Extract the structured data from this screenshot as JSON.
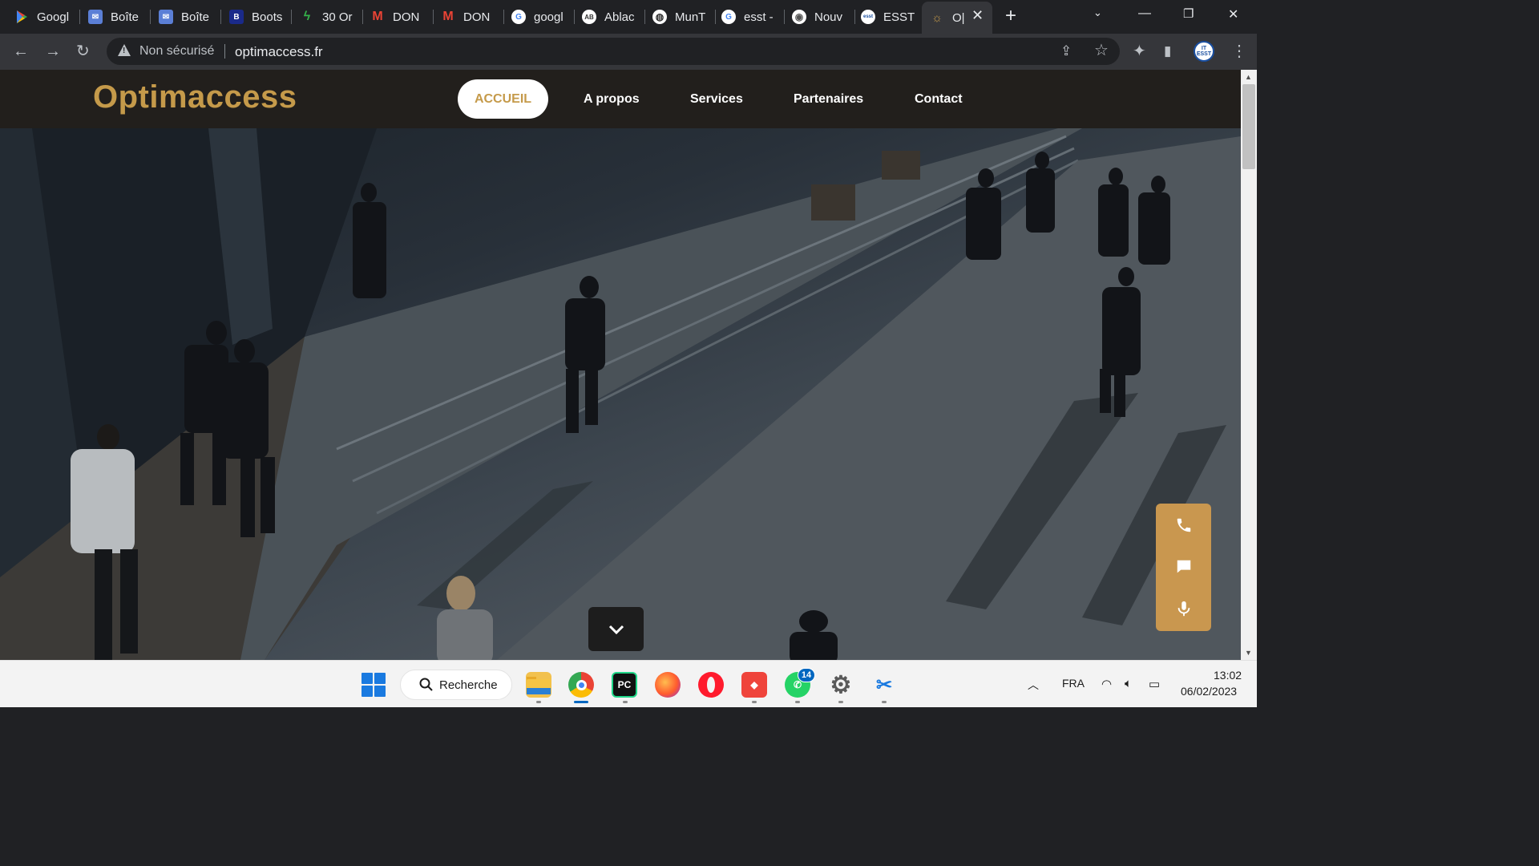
{
  "browser": {
    "tabs": [
      {
        "title": "Googl",
        "icon": "google-play-icon",
        "color": "#34a853"
      },
      {
        "title": "Boîte",
        "icon": "mail-icon",
        "color": "#5b7fd6"
      },
      {
        "title": "Boîte",
        "icon": "mail-icon",
        "color": "#5b7fd6"
      },
      {
        "title": "Boots",
        "icon": "bootstrap-icon",
        "color": "#1a2a8a"
      },
      {
        "title": "30 Or",
        "icon": "leaf-icon",
        "color": "#35b34a"
      },
      {
        "title": "DON",
        "icon": "gmail-icon",
        "color": "#ea4335"
      },
      {
        "title": "DON",
        "icon": "gmail-icon",
        "color": "#ea4335"
      },
      {
        "title": "googl",
        "icon": "google-icon",
        "color": "#ffffff"
      },
      {
        "title": "Ablac",
        "icon": "ab-icon",
        "color": "#ffffff"
      },
      {
        "title": "MunT",
        "icon": "globe-icon",
        "color": "#ffffff"
      },
      {
        "title": "esst -",
        "icon": "google-icon",
        "color": "#ffffff"
      },
      {
        "title": "Nouv",
        "icon": "chrome-icon",
        "color": "#ffffff"
      },
      {
        "title": "ESST",
        "icon": "esst-icon",
        "color": "#ffffff"
      },
      {
        "title": "O|",
        "icon": "optimaccess-icon",
        "color": "#c59a4a"
      }
    ],
    "new_tab": "+",
    "security_label": "Non sécurisé",
    "url": "optimaccess.fr",
    "profile_label": "IT ESST"
  },
  "site": {
    "logo": "Optimaccess",
    "nav": {
      "accueil": "ACCUEIL",
      "apropos": "A propos",
      "services": "Services",
      "partenaires": "Partenaires",
      "contact": "Contact"
    },
    "accent_color": "#c59a4a",
    "contact_widget": [
      "phone-icon",
      "chat-icon",
      "microphone-icon"
    ]
  },
  "taskbar": {
    "search_label": "Recherche",
    "whatsapp_badge": "14",
    "language": "FRA",
    "time": "13:02",
    "date": "06/02/2023",
    "apps": [
      "file-explorer-icon",
      "chrome-icon",
      "pycharm-icon",
      "firefox-icon",
      "opera-icon",
      "anydesk-icon",
      "whatsapp-icon",
      "settings-icon",
      "snipping-tool-icon"
    ]
  }
}
